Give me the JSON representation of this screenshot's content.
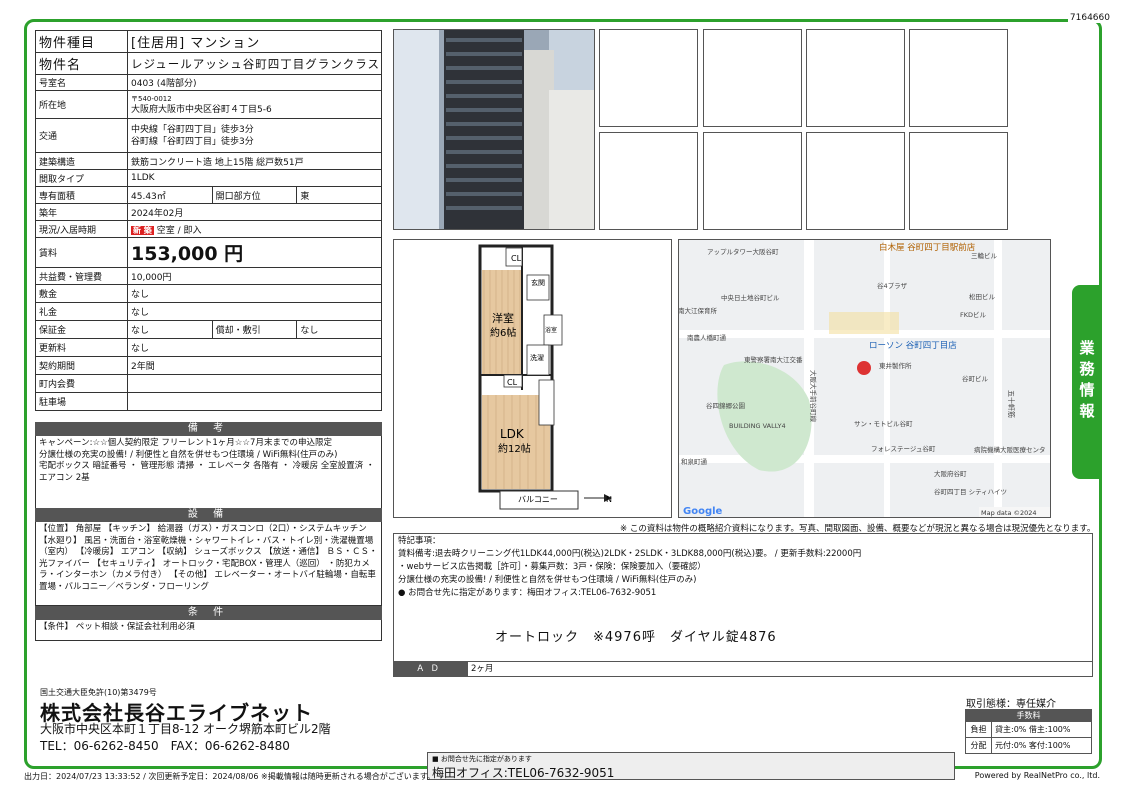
{
  "doc_id": "7164660",
  "property": {
    "type_label": "物件種目",
    "type_value": "[住居用] マンション",
    "name_label": "物件名",
    "name_value": "レジュールアッシュ谷町四丁目グランクラス",
    "room_label": "号室名",
    "room_value": "0403 (4階部分)",
    "addr_label": "所在地",
    "postal": "〒540-0012",
    "addr_value": "大阪府大阪市中央区谷町４丁目5-6",
    "traffic_label": "交通",
    "traffic_1": "中央線「谷町四丁目」徒歩3分",
    "traffic_2": "谷町線「谷町四丁目」徒歩3分",
    "structure_label": "建築構造",
    "structure_value": "鉄筋コンクリート造 地上15階 総戸数51戸",
    "layout_label": "間取タイプ",
    "layout_value": "1LDK",
    "area_label": "専有面積",
    "area_value": "45.43㎡",
    "dir_label": "開口部方位",
    "dir_value": "東",
    "built_label": "築年",
    "built_value": "2024年02月",
    "status_label": "現況/入居時期",
    "status_new": "新 築",
    "status_value": "空室 / 即入",
    "rent_label": "賃料",
    "rent_value": "153,000 円",
    "fee_label": "共益費・管理費",
    "fee_value": "10,000円",
    "shiki_label": "敷金",
    "shiki_value": "なし",
    "rei_label": "礼金",
    "rei_value": "なし",
    "hosho_label": "保証金",
    "hosho_value": "なし",
    "shokyaku_label": "償却・敷引",
    "shokyaku_value": "なし",
    "koushin_label": "更新料",
    "koushin_value": "なし",
    "period_label": "契約期間",
    "period_value": "2年間",
    "chonai_label": "町内会費",
    "chonai_value": "",
    "parking_label": "駐車場",
    "parking_value": ""
  },
  "remarks": {
    "header": "備 考",
    "text": "キャンペーン:☆☆個人契約限定 フリーレント1ヶ月☆☆7月末までの申込限定\n分譲仕様の充実の設備! / 利便性と自然を併せもつ住環境 / WiFi無料(住戸のみ)\n宅配ボックス 暗証番号 ・ 管理形態 清掃 ・ エレベータ 各階有 ・ 冷暖房 全室設置済 ・ エアコン 2基"
  },
  "equipment": {
    "header": "設 備",
    "text": "【位置】 角部屋 【キッチン】 給湯器（ガス）・ガスコンロ（2口）・システムキッチン 【水廻り】 風呂・洗面台・浴室乾燥機・シャワートイレ・バス・トイレ別・洗濯機置場（室内） 【冷暖房】 エアコン 【収納】 シューズボックス 【放送・通信】 ＢＳ・ＣＳ・光ファイバー 【セキュリティ】 オートロック・宅配BOX・管理人（巡回） ・防犯カメラ・インターホン（カメラ付き） 【その他】 エレベーター・オートバイ駐輪場・自転車置場・バルコニー／ベランダ・フローリング"
  },
  "conditions": {
    "header": "条 件",
    "text": "【条件】 ペット相談・保証会社利用必須"
  },
  "floorplan": {
    "room1": "洋室",
    "room1_size": "約6帖",
    "ldk": "LDK",
    "ldk_size": "約12帖",
    "cl": "CL",
    "genkan": "玄関",
    "sentaku": "洗濯",
    "yoku": "浴室",
    "balcony": "バルコニー",
    "north": "N"
  },
  "map": {
    "labels": [
      "アップルタワー大阪谷町",
      "南大江保育所",
      "中央日土地谷町ビル",
      "谷4プラザ",
      "三輪ビル",
      "松田ビル",
      "FKDビル",
      "南農人橋町通",
      "東警察署南大江交番",
      "東井製作所",
      "谷町ビル",
      "谷四錦郷公園",
      "BUILDING VALLY4",
      "サン・モトビル谷町",
      "フォレステージュ谷町",
      "和泉町通",
      "病院機構大阪医療センタ",
      "大阪府谷町",
      "谷町四丁目 シティハイツ",
      "ローソン 谷町四丁目店",
      "白木屋 谷町四丁目駅前店",
      "五十軒筋",
      "大阪大手前谷町線",
      "Map data ©2024"
    ],
    "google": "Google"
  },
  "disclaimer": "※ この資料は物件の概略紹介資料になります。写真、間取図面、設備、概要などが現況と異なる場合は現況優先となります。",
  "notes": {
    "title": "特記事項：",
    "line1": "賃料備考:退去時クリーニング代1LDK44,000円(税込)2LDK・2SLDK・3LDK88,000円(税込)要。 / 更新手数料:22000円",
    "line2": "・webサービス広告掲載［許可］・募集戸数：3戸・保険：保険要加入（要確認）",
    "line3": "分譲仕様の充実の設備! / 利便性と自然を併せもつ住環境 / WiFi無料(住戸のみ)",
    "line4": "● お問合せ先に指定があります：梅田オフィス:TEL06-7632-9051",
    "autolock": "オートロック　※4976呼　ダイヤル錠4876",
    "ad_label": "ＡＤ",
    "ad_value": "2ヶ月"
  },
  "tab": "業務情報",
  "company": {
    "license": "国土交通大臣免許(10)第3479号",
    "name": "株式会社長谷エライブネット",
    "addr": "大阪市中央区本町１丁目8-12 オーク堺筋本町ビル2階",
    "tel": "TEL：06-6262-8450　FAX：06-6262-8480"
  },
  "contact": {
    "small": "■ お問合せ先に指定があります",
    "big": "梅田オフィス:TEL06-7632-9051"
  },
  "fees": {
    "title": "取引態様：専任媒介",
    "header": "手数料",
    "r1_label": "負担",
    "r1_value": "貸主:0% 借主:100%",
    "r2_label": "分配",
    "r2_value": "元付:0% 客付:100%"
  },
  "footer": "出力日：2024/07/23 13:33:52 / 次回更新予定日：2024/08/06 ※掲載情報は随時更新される場合がございます。",
  "powered": "Powered by RealNetPro co., ltd.",
  "colors": {
    "accent_green": "#2ca12c",
    "header_gray": "#555555",
    "new_red": "#dd2222"
  }
}
